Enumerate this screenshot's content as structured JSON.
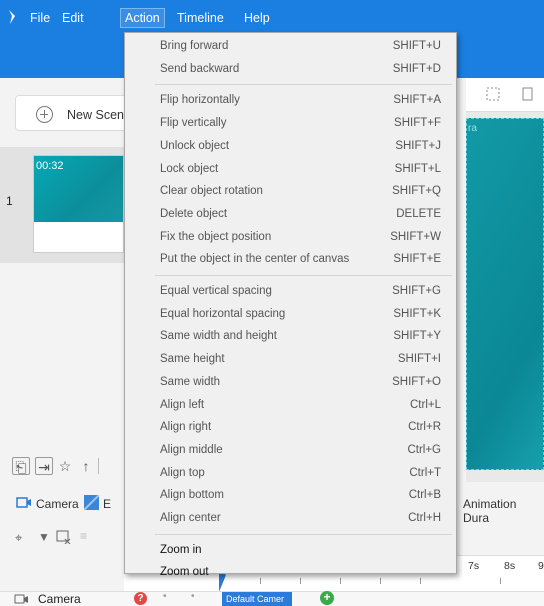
{
  "menubar": {
    "items": [
      "File",
      "Edit",
      "Action",
      "Timeline",
      "Help"
    ],
    "active_index": 2
  },
  "left_panel": {
    "new_scene_label": "New Scen",
    "scene": {
      "number": "1",
      "duration": "00:32"
    }
  },
  "canvas": {
    "label": "ra"
  },
  "tabs_row": {
    "camera_label": "Camera",
    "second_label": "E",
    "animation_duration_label": "Animation Dura"
  },
  "timeline": {
    "ticks": [
      "7s",
      "8s",
      "9"
    ],
    "track_label": "Camera",
    "default_camera_label": "Default Camer",
    "help_label": "?",
    "add_label": "+"
  },
  "action_menu": {
    "groups": [
      [
        {
          "label": "Bring forward",
          "shortcut": "SHIFT+U"
        },
        {
          "label": "Send backward",
          "shortcut": "SHIFT+D"
        }
      ],
      [
        {
          "label": "Flip horizontally",
          "shortcut": "SHIFT+A"
        },
        {
          "label": "Flip vertically",
          "shortcut": "SHIFT+F"
        },
        {
          "label": "Unlock object",
          "shortcut": "SHIFT+J"
        },
        {
          "label": "Lock object",
          "shortcut": "SHIFT+L"
        },
        {
          "label": "Clear object rotation",
          "shortcut": "SHIFT+Q"
        },
        {
          "label": "Delete object",
          "shortcut": "DELETE"
        },
        {
          "label": "Fix the object position",
          "shortcut": "SHIFT+W"
        },
        {
          "label": "Put the object in the center of canvas",
          "shortcut": "SHIFT+E"
        }
      ],
      [
        {
          "label": "Equal vertical spacing",
          "shortcut": "SHIFT+G"
        },
        {
          "label": "Equal horizontal spacing",
          "shortcut": "SHIFT+K"
        },
        {
          "label": "Same width and height",
          "shortcut": "SHIFT+Y"
        },
        {
          "label": "Same height",
          "shortcut": "SHIFT+I"
        },
        {
          "label": "Same width",
          "shortcut": "SHIFT+O"
        },
        {
          "label": "Align left",
          "shortcut": "Ctrl+L"
        },
        {
          "label": "Align right",
          "shortcut": "Ctrl+R"
        },
        {
          "label": "Align middle",
          "shortcut": "Ctrl+G"
        },
        {
          "label": "Align top",
          "shortcut": "Ctrl+T"
        },
        {
          "label": "Align bottom",
          "shortcut": "Ctrl+B"
        },
        {
          "label": "Align center",
          "shortcut": "Ctrl+H"
        }
      ],
      [
        {
          "label": "Zoom in",
          "shortcut": ""
        },
        {
          "label": "Zoom out",
          "shortcut": ""
        }
      ]
    ]
  },
  "colors": {
    "accent": "#1a7fe0",
    "canvas": "#0b8795",
    "help": "#e84545",
    "add": "#3aa94a"
  }
}
